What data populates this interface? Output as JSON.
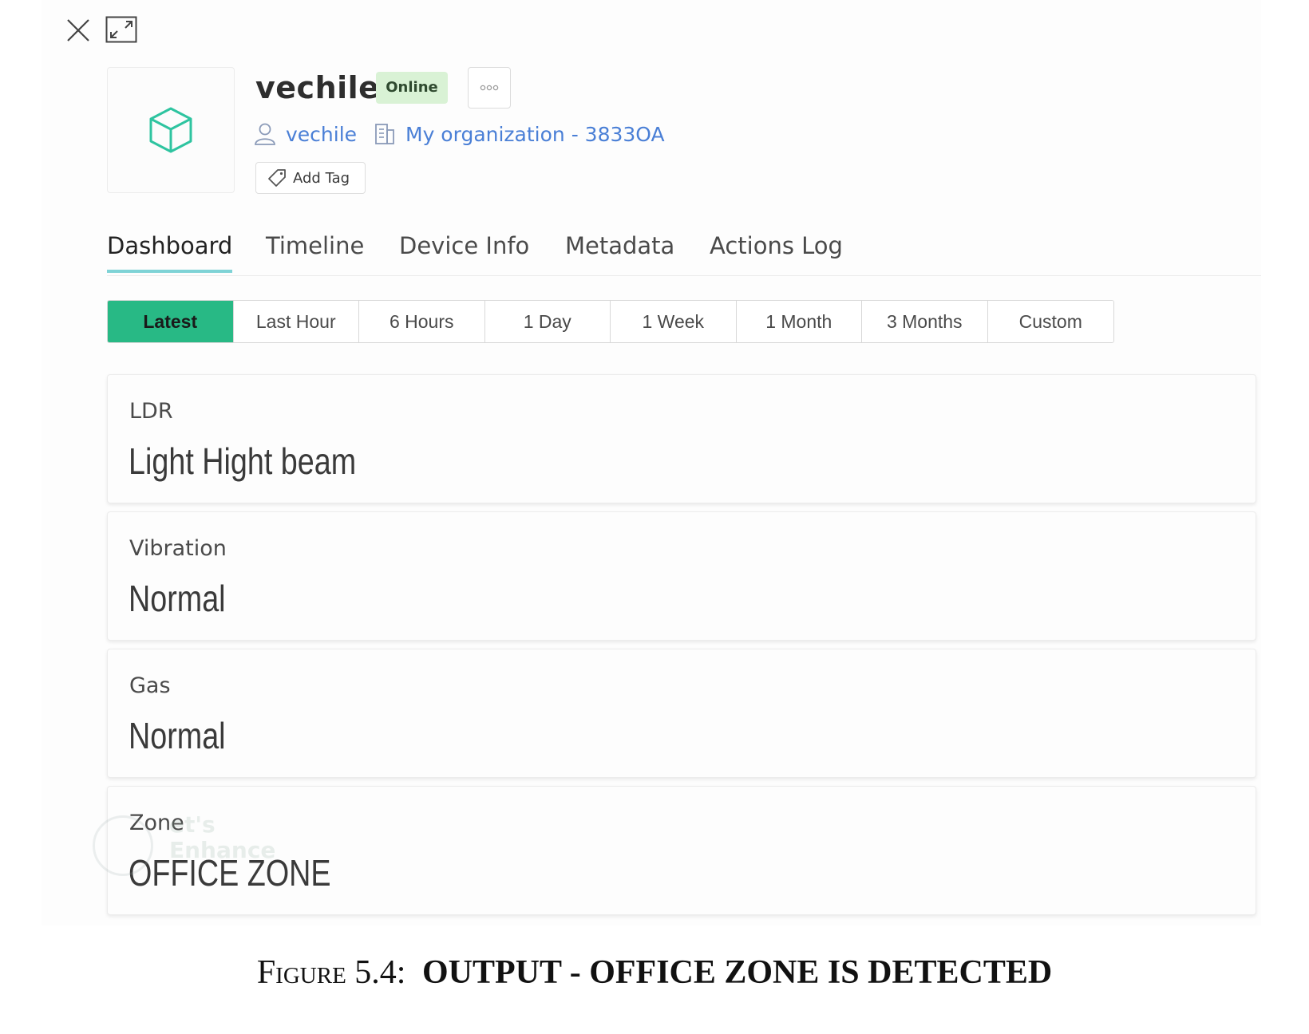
{
  "device": {
    "name": "vechile",
    "status": "Online",
    "owner": "vechile",
    "organization": "My organization - 3833OA",
    "add_tag_label": "Add Tag"
  },
  "tabs": [
    {
      "label": "Dashboard",
      "active": true
    },
    {
      "label": "Timeline",
      "active": false
    },
    {
      "label": "Device Info",
      "active": false
    },
    {
      "label": "Metadata",
      "active": false
    },
    {
      "label": "Actions Log",
      "active": false
    }
  ],
  "time_ranges": [
    {
      "label": "Latest",
      "active": true
    },
    {
      "label": "Last Hour",
      "active": false
    },
    {
      "label": "6 Hours",
      "active": false
    },
    {
      "label": "1 Day",
      "active": false
    },
    {
      "label": "1 Week",
      "active": false
    },
    {
      "label": "1 Month",
      "active": false
    },
    {
      "label": "3 Months",
      "active": false
    },
    {
      "label": "Custom",
      "active": false
    }
  ],
  "widgets": [
    {
      "label": "LDR",
      "value": "Light Hight beam"
    },
    {
      "label": "Vibration",
      "value": "Normal"
    },
    {
      "label": "Gas",
      "value": "Normal"
    },
    {
      "label": "Zone",
      "value": "OFFICE ZONE"
    }
  ],
  "watermark": {
    "line1": "et's",
    "line2": "Enhance"
  },
  "caption": {
    "prefix": "Figure 5.4:",
    "title": "OUTPUT - OFFICE ZONE IS DETECTED"
  },
  "colors": {
    "accent_green": "#28b985",
    "online_badge": "#d9f2d5",
    "link_blue": "#4a7fd6",
    "tab_underline": "#7fd3d6",
    "cube_icon": "#2ec4a0"
  },
  "icons": [
    "close-icon",
    "expand-icon",
    "cube-icon",
    "more-dots-icon",
    "user-icon",
    "building-icon",
    "tag-icon"
  ]
}
